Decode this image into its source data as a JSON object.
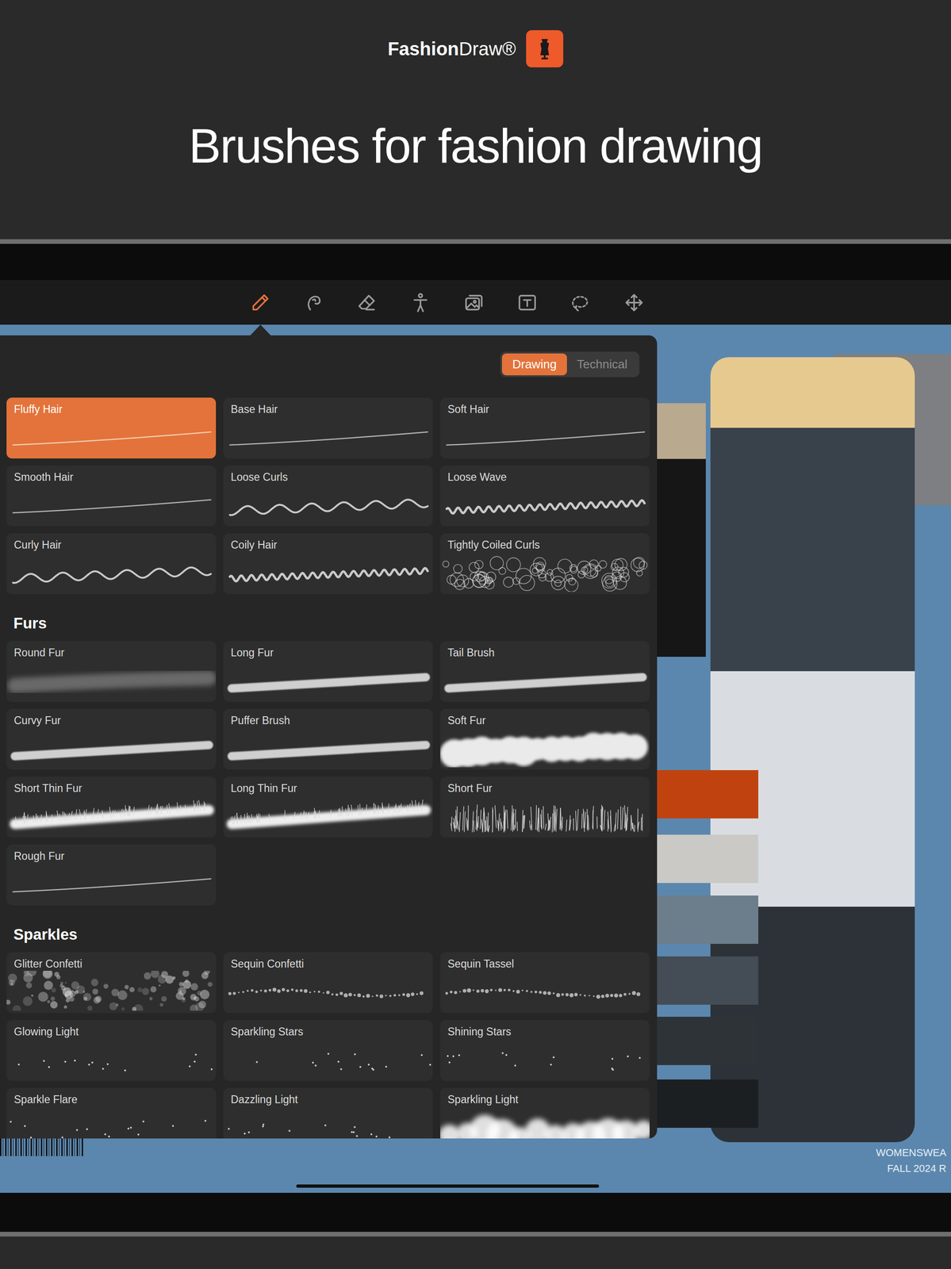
{
  "header": {
    "brand_bold": "Fashion",
    "brand_light": "Draw®",
    "headline": "Brushes for fashion drawing"
  },
  "toolbar": [
    {
      "selected": true
    },
    {
      "selected": false
    },
    {
      "selected": false
    },
    {
      "selected": false
    },
    {
      "selected": false
    },
    {
      "selected": false
    },
    {
      "selected": false
    },
    {
      "selected": false
    }
  ],
  "brush_panel": {
    "segments": [
      {
        "label": "Drawing",
        "selected": true
      },
      {
        "label": "Technical",
        "selected": false
      }
    ],
    "groups": [
      {
        "brushes": [
          {
            "name": "Fluffy Hair",
            "selected": true,
            "kind": "strand"
          },
          {
            "name": "Base Hair",
            "selected": false,
            "kind": "strand"
          },
          {
            "name": "Soft Hair",
            "selected": false,
            "kind": "strand"
          },
          {
            "name": "Smooth Hair",
            "selected": false,
            "kind": "strand"
          },
          {
            "name": "Loose Curls",
            "selected": false,
            "kind": "wave"
          },
          {
            "name": "Loose Wave",
            "selected": false,
            "kind": "coil"
          },
          {
            "name": "Curly Hair",
            "selected": false,
            "kind": "wave"
          },
          {
            "name": "Coily Hair",
            "selected": false,
            "kind": "coil"
          },
          {
            "name": "Tightly Coiled Curls",
            "selected": false,
            "kind": "loops"
          }
        ]
      },
      {
        "title": "Furs",
        "brushes": [
          {
            "name": "Round Fur",
            "selected": false,
            "kind": "haze"
          },
          {
            "name": "Long Fur",
            "selected": false,
            "kind": "band"
          },
          {
            "name": "Tail Brush",
            "selected": false,
            "kind": "band"
          },
          {
            "name": "Curvy Fur",
            "selected": false,
            "kind": "band"
          },
          {
            "name": "Puffer Brush",
            "selected": false,
            "kind": "band"
          },
          {
            "name": "Soft Fur",
            "selected": false,
            "kind": "cloud"
          },
          {
            "name": "Short Thin Fur",
            "selected": false,
            "kind": "fluff"
          },
          {
            "name": "Long Thin Fur",
            "selected": false,
            "kind": "fluff"
          },
          {
            "name": "Short Fur",
            "selected": false,
            "kind": "spikes"
          },
          {
            "name": "Rough Fur",
            "selected": false,
            "kind": "strand"
          }
        ]
      },
      {
        "title": "Sparkles",
        "brushes": [
          {
            "name": "Glitter Confetti",
            "selected": false,
            "kind": "bokeh"
          },
          {
            "name": "Sequin Confetti",
            "selected": false,
            "kind": "dots"
          },
          {
            "name": "Sequin Tassel",
            "selected": false,
            "kind": "dots"
          },
          {
            "name": "Glowing Light",
            "selected": false,
            "kind": "stars"
          },
          {
            "name": "Sparkling Stars",
            "selected": false,
            "kind": "stars"
          },
          {
            "name": "Shining Stars",
            "selected": false,
            "kind": "stars"
          },
          {
            "name": "Sparkle Flare",
            "selected": false,
            "kind": "stars"
          },
          {
            "name": "Dazzling Light",
            "selected": false,
            "kind": "stars"
          },
          {
            "name": "Sparkling Light",
            "selected": false,
            "kind": "glow"
          }
        ]
      }
    ]
  },
  "swatches": [
    {
      "color": "#c0430f"
    },
    {
      "color": "#cac9c6"
    },
    {
      "color": "#6c7d8b"
    },
    {
      "color": "#444c55"
    },
    {
      "color": "#2e3338"
    },
    {
      "color": "#1c1f22"
    }
  ],
  "canvas_caption": [
    "WOMENSWEA",
    "FALL 2024 R"
  ]
}
